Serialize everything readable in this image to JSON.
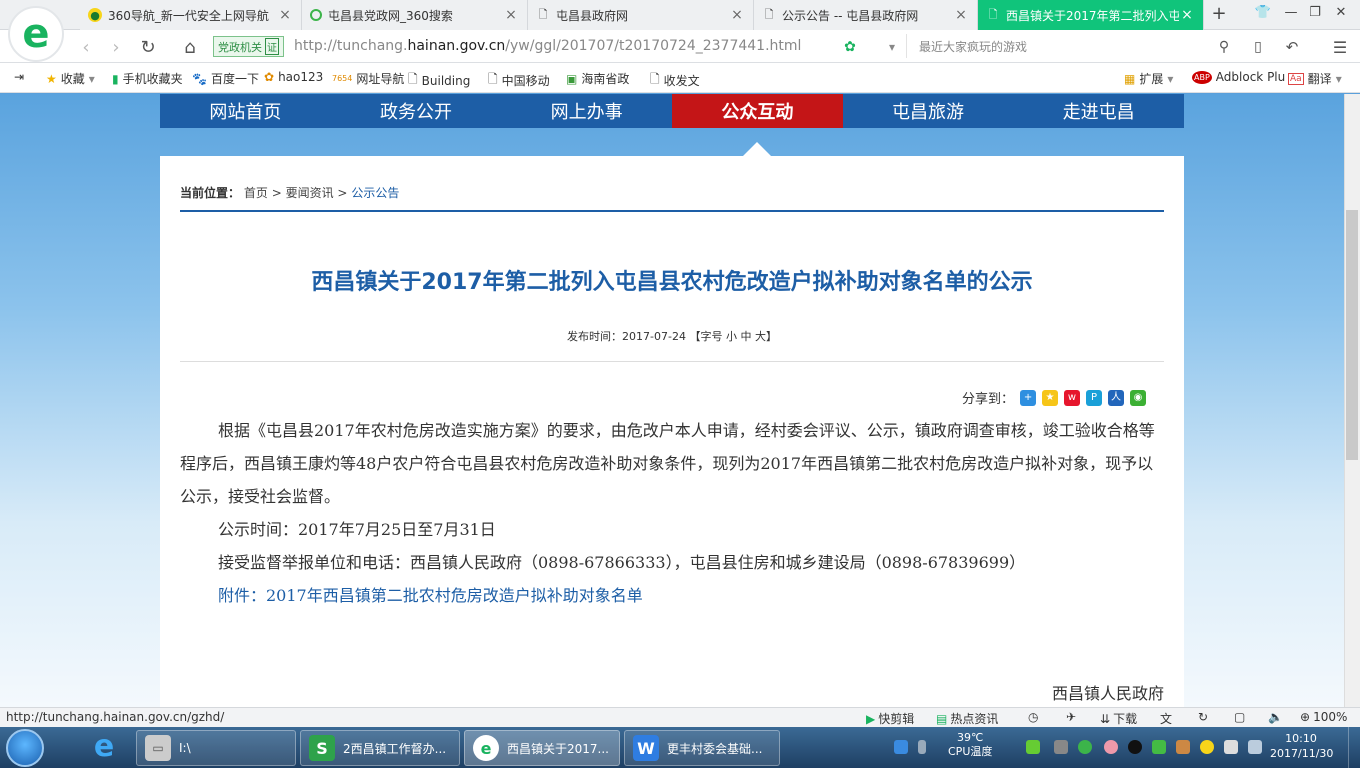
{
  "browser": {
    "tabs": [
      {
        "label": "360导航_新一代安全上网导航",
        "icon": "360-icon",
        "active": false
      },
      {
        "label": "屯昌县党政网_360搜索",
        "icon": "search-icon",
        "active": false
      },
      {
        "label": "屯昌县政府网",
        "icon": "page-icon",
        "active": false
      },
      {
        "label": "公示公告 -- 屯昌县政府网",
        "icon": "page-icon",
        "active": false
      },
      {
        "label": "西昌镇关于2017年第二批列入屯",
        "icon": "page-icon",
        "active": true
      }
    ],
    "new_tab": "+",
    "gov_badge": "党政机关",
    "gov_badge_mark": "证",
    "url_prefix": "http://tunchang.",
    "url_domain": "hainan.gov.cn",
    "url_suffix": "/yw/ggl/201707/t20170724_2377441.html",
    "search_placeholder": "最近大家疯玩的游戏",
    "bookmarks": [
      {
        "label": "收藏",
        "icon": "star-icon"
      },
      {
        "label": "手机收藏夹",
        "icon": "phone-icon"
      },
      {
        "label": "百度一下",
        "icon": "baidu-icon"
      },
      {
        "label": "hao123",
        "icon": "hao123-icon"
      },
      {
        "label": "网址导航",
        "icon": "nav-icon"
      },
      {
        "label": "Building",
        "icon": "page-icon"
      },
      {
        "label": "中国移动",
        "icon": "page-icon"
      },
      {
        "label": "海南省政",
        "icon": "image-icon"
      },
      {
        "label": "收发文",
        "icon": "page-icon"
      }
    ],
    "bm_right": {
      "ext": "扩展",
      "adblock": "Adblock Plu",
      "translate": "翻译"
    }
  },
  "site": {
    "nav": [
      "网站首页",
      "政务公开",
      "网上办事",
      "公众互动",
      "屯昌旅游",
      "走进屯昌"
    ],
    "active_nav": "公众互动",
    "crumb_label": "当前位置：",
    "crumbs": [
      "首页",
      "要闻资讯",
      "公示公告"
    ],
    "crumb_sep": ">",
    "title": "西昌镇关于2017年第二批列入屯昌县农村危改造户拟补助对象名单的公示",
    "meta": "发布时间：2017-07-24  【字号 小 中 大】",
    "share_label": "分享到：",
    "paragraphs": {
      "p1": "根据《屯昌县2017年农村危房改造实施方案》的要求，由危改户本人申请，经村委会评议、公示，镇政府调查审核，竣工验收合格等程序后，西昌镇王康灼等48户农户符合屯昌县农村危房改造补助对象条件，现列为2017年西昌镇第二批农村危房改造户拟补对象，现予以公示，接受社会监督。",
      "p2": "公示时间：2017年7月25日至7月31日",
      "p3": "接受监督举报单位和电话：西昌镇人民政府（0898-67866333），屯昌县住房和城乡建设局（0898-67839699）",
      "p4": "附件：2017年西昌镇第二批农村危房改造户拟补助对象名单"
    },
    "signature": "西昌镇人民政府"
  },
  "status": {
    "url": "http://tunchang.hainan.gov.cn/gzhd/",
    "quick_clip": "快剪辑",
    "hot": "热点资讯",
    "download": "下载",
    "zoom": "100%"
  },
  "taskbar": {
    "items": [
      {
        "label": "I:\\",
        "icon": "drive-icon"
      },
      {
        "label": "2西昌镇工作督办...",
        "icon": "wps-sheet-icon"
      },
      {
        "label": "西昌镇关于2017...",
        "icon": "browser-icon"
      },
      {
        "label": "更丰村委会基础...",
        "icon": "wps-writer-icon"
      }
    ],
    "temp": "39℃",
    "temp_label": "CPU温度",
    "time": "10:10",
    "date": "2017/11/30"
  }
}
